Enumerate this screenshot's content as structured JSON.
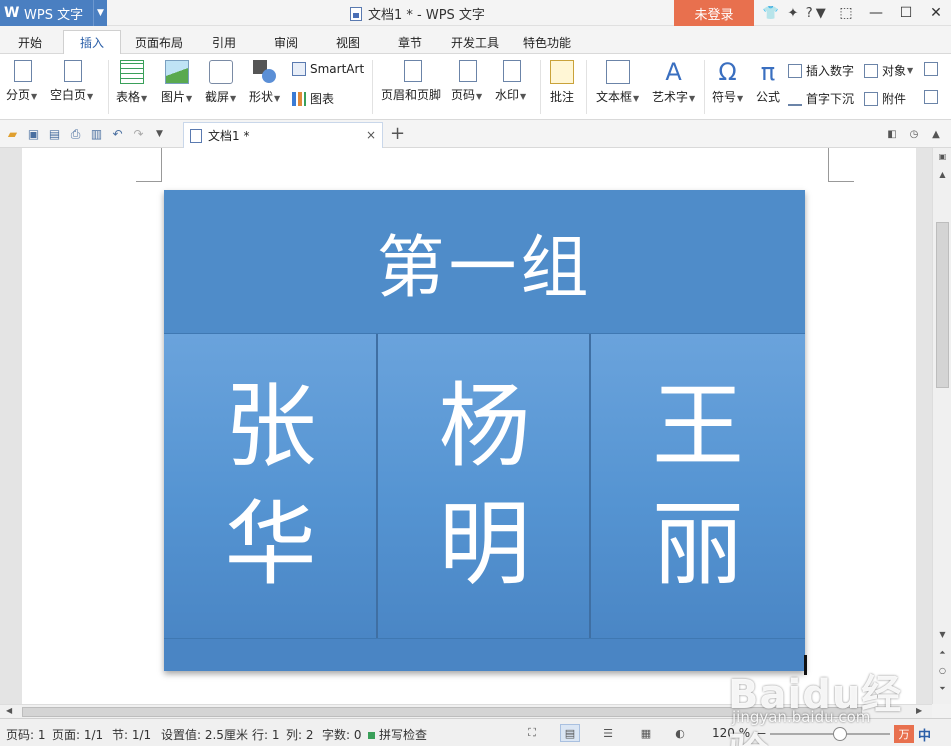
{
  "app": {
    "name": "WPS 文字",
    "window_title": "文档1 * - WPS 文字",
    "login_label": "未登录",
    "help_label": "?"
  },
  "ribbon_tabs": [
    "开始",
    "插入",
    "页面布局",
    "引用",
    "审阅",
    "视图",
    "章节",
    "开发工具",
    "特色功能"
  ],
  "active_tab": "插入",
  "ribbon": {
    "page_break": "分页",
    "blank_page": "空白页",
    "table": "表格",
    "picture": "图片",
    "screenshot": "截屏",
    "shapes": "形状",
    "smartart": "SmartArt",
    "chart": "图表",
    "header_footer": "页眉和页脚",
    "page_number": "页码",
    "watermark": "水印",
    "comment": "批注",
    "textbox": "文本框",
    "wordart": "艺术字",
    "symbol": "符号",
    "formula": "公式",
    "insert_number": "插入数字",
    "dropcap": "首字下沉",
    "object": "对象",
    "attachment": "附件"
  },
  "document_tab": {
    "name": "文档1 *",
    "close": "×",
    "new": "+"
  },
  "document": {
    "group_title": "第一组",
    "members": [
      {
        "line1": "张",
        "line2": "华"
      },
      {
        "line1": "杨",
        "line2": "明"
      },
      {
        "line1": "王",
        "line2": "丽"
      }
    ]
  },
  "status": {
    "page_num": "页码: 1",
    "pages": "页面: 1/1",
    "section": "节: 1/1",
    "setting": "设置值: 2.5厘米",
    "row": "行: 1",
    "col": "列: 2",
    "word_count": "字数: 0",
    "spell_check": "拼写检查",
    "zoom": "120 %"
  },
  "ime": {
    "badge": "万",
    "lang": "中"
  },
  "watermark": {
    "brand": "Baidu经验",
    "url": "jingyan.baidu.com"
  },
  "colors": {
    "brand_blue": "#4a7fc1",
    "login_orange": "#e8704e",
    "smartart_blue": "#4f8cc9"
  }
}
